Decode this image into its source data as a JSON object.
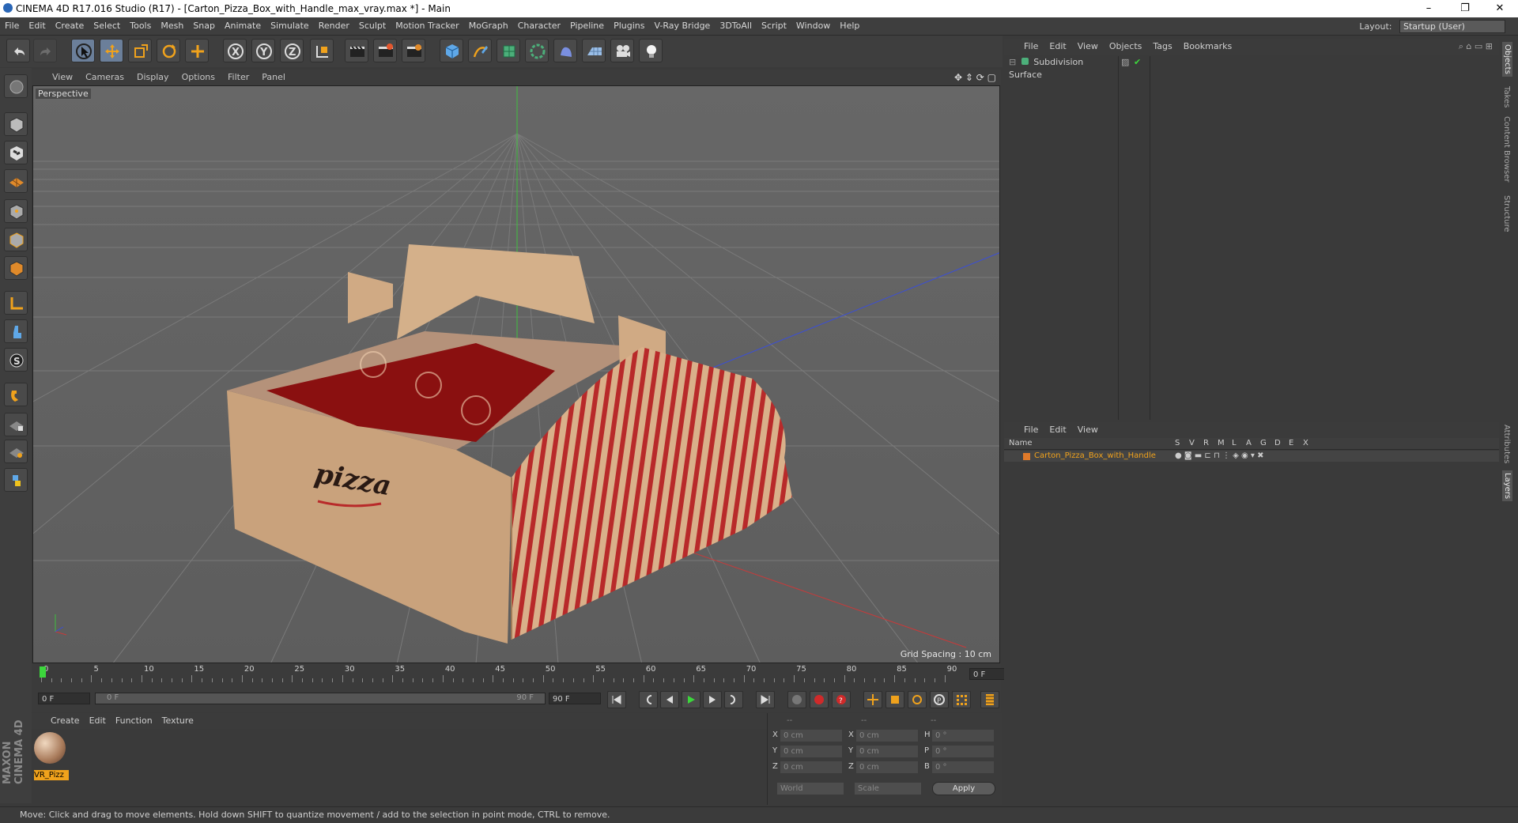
{
  "window": {
    "title": "CINEMA 4D R17.016 Studio (R17) - [Carton_Pizza_Box_with_Handle_max_vray.max *] - Main",
    "controls": [
      "–",
      "❐",
      "✕"
    ]
  },
  "menubar": {
    "items": [
      "File",
      "Edit",
      "Create",
      "Select",
      "Tools",
      "Mesh",
      "Snap",
      "Animate",
      "Simulate",
      "Render",
      "Sculpt",
      "Motion Tracker",
      "MoGraph",
      "Character",
      "Pipeline",
      "Plugins",
      "V-Ray Bridge",
      "3DToAll",
      "Script",
      "Window",
      "Help"
    ],
    "layout_label": "Layout:",
    "layout_value": "Startup (User)"
  },
  "toolbar": {
    "icons": [
      "undo-icon",
      "redo-icon",
      "select-arrow-icon",
      "move-icon",
      "scale-icon",
      "rotate-icon",
      "last-tool-icon",
      "x-axis-icon",
      "y-axis-icon",
      "z-axis-icon",
      "world-coord-icon",
      "render-view-icon",
      "render-picture-icon",
      "edit-render-settings-icon",
      "cube-icon",
      "spline-pen-icon",
      "subdivision-icon",
      "array-icon",
      "deformer-icon",
      "floor-icon",
      "camera-icon",
      "light-icon"
    ]
  },
  "viewport": {
    "menu": [
      "View",
      "Cameras",
      "Display",
      "Options",
      "Filter",
      "Panel"
    ],
    "label": "Perspective",
    "grid_spacing": "Grid Spacing : 10 cm",
    "pizza_text": "pizza"
  },
  "timeline": {
    "ticks": [
      "0",
      "5",
      "10",
      "15",
      "20",
      "25",
      "30",
      "35",
      "40",
      "45",
      "50",
      "55",
      "60",
      "65",
      "70",
      "75",
      "80",
      "85",
      "90"
    ],
    "frame_field": "0 F",
    "start": "0 F",
    "range_start": "0 F",
    "range_end": "90 F",
    "end": "90 F"
  },
  "material": {
    "menu": [
      "Create",
      "Edit",
      "Function",
      "Texture"
    ],
    "name": "VR_Pizz"
  },
  "coords": {
    "header": [
      "--",
      "--",
      "--"
    ],
    "rows": [
      {
        "a": "X",
        "av": "0 cm",
        "b": "X",
        "bv": "0 cm",
        "c": "H",
        "cv": "0 °"
      },
      {
        "a": "Y",
        "av": "0 cm",
        "b": "Y",
        "bv": "0 cm",
        "c": "P",
        "cv": "0 °"
      },
      {
        "a": "Z",
        "av": "0 cm",
        "b": "Z",
        "bv": "0 cm",
        "c": "B",
        "cv": "0 °"
      }
    ],
    "world": "World",
    "scale": "Scale",
    "apply": "Apply"
  },
  "objects": {
    "menu": [
      "File",
      "Edit",
      "View",
      "Objects",
      "Tags",
      "Bookmarks"
    ],
    "item": "Subdivision Surface"
  },
  "layers": {
    "menu": [
      "File",
      "Edit",
      "View"
    ],
    "col_name": "Name",
    "cols": [
      "S",
      "V",
      "R",
      "M",
      "L",
      "A",
      "G",
      "D",
      "E",
      "X"
    ],
    "item": "Carton_Pizza_Box_with_Handle",
    "item_color": "#e07a2a"
  },
  "sidetabs": [
    "Objects",
    "Takes",
    "Content Browser",
    "Structure",
    "Attributes",
    "Layers"
  ],
  "status": "Move: Click and drag to move elements. Hold down SHIFT to quantize movement / add to the selection in point mode, CTRL to remove.",
  "brand": "MAXON CINEMA 4D"
}
